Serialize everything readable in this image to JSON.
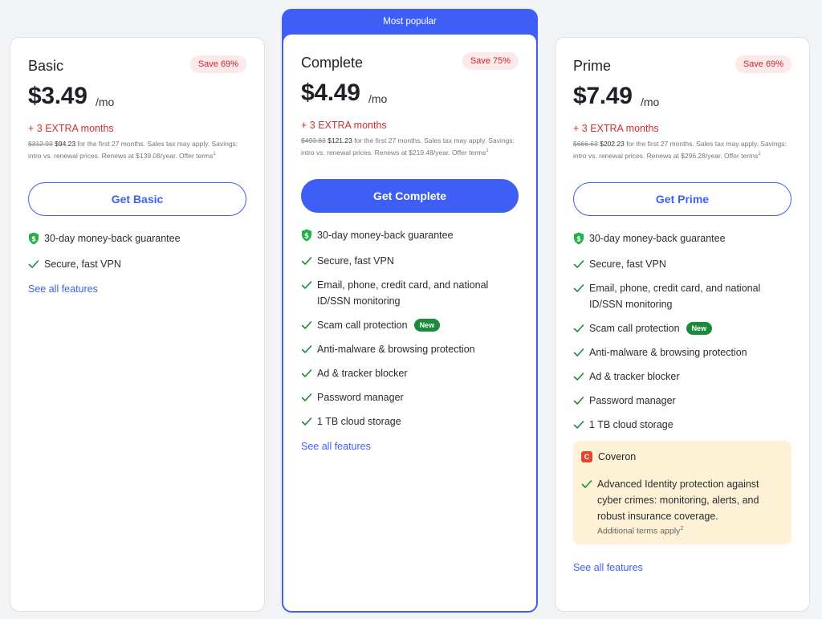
{
  "plans": {
    "basic": {
      "name": "Basic",
      "save": "Save 69%",
      "price": "$3.49",
      "per": "/mo",
      "extra": "+ 3 EXTRA months",
      "old_price": "$312.93",
      "new_price": "$94.23",
      "fine_text": " for the first 27 months. Sales tax may apply. Savings: intro vs. renewal prices. Renews at $139.08/year. Offer terms",
      "fine_sup": "1",
      "button": "Get Basic",
      "guarantee": "30-day money-back guarantee",
      "features": [
        "Secure, fast VPN"
      ],
      "see_all": "See all features"
    },
    "complete": {
      "popular": "Most popular",
      "name": "Complete",
      "save": "Save 75%",
      "price": "$4.49",
      "per": "/mo",
      "extra": "+ 3 EXTRA months",
      "old_price": "$493.83",
      "new_price": "$121.23",
      "fine_text": " for the first 27 months. Sales tax may apply. Savings: intro vs. renewal prices. Renews at $219.48/year. Offer terms",
      "fine_sup": "1",
      "button": "Get Complete",
      "guarantee": "30-day money-back guarantee",
      "features": [
        "Secure, fast VPN",
        "Email, phone, credit card, and national ID/SSN monitoring",
        "Scam call protection",
        "Anti-malware & browsing protection",
        "Ad & tracker blocker",
        "Password manager",
        "1 TB cloud storage"
      ],
      "new_badge": "New",
      "see_all": "See all features"
    },
    "prime": {
      "name": "Prime",
      "save": "Save 69%",
      "price": "$7.49",
      "per": "/mo",
      "extra": "+ 3 EXTRA months",
      "old_price": "$666.63",
      "new_price": "$202.23",
      "fine_text": " for the first 27 months. Sales tax may apply. Savings: intro vs. renewal prices. Renews at $296.28/year. Offer terms",
      "fine_sup": "1",
      "button": "Get Prime",
      "guarantee": "30-day money-back guarantee",
      "features": [
        "Secure, fast VPN",
        "Email, phone, credit card, and national ID/SSN monitoring",
        "Scam call protection",
        "Anti-malware & browsing protection",
        "Ad & tracker blocker",
        "Password manager",
        "1 TB cloud storage"
      ],
      "new_badge": "New",
      "coveron": {
        "logo": "C",
        "title": "Coveron",
        "feature": "Advanced Identity protection against cyber crimes: monitoring, alerts, and robust insurance coverage.",
        "terms": "Additional terms apply",
        "terms_sup": "2"
      },
      "see_all": "See all features"
    }
  },
  "icons": {
    "check": "check-icon",
    "shield": "shield-dollar-icon",
    "coveron": "coveron-logo-icon"
  },
  "colors": {
    "accent": "#3e5ff5",
    "save_red": "#c8272c",
    "new_green": "#1a8a3b",
    "check_green": "#1a8a3b",
    "coveron_bg": "#fdf2d6"
  }
}
